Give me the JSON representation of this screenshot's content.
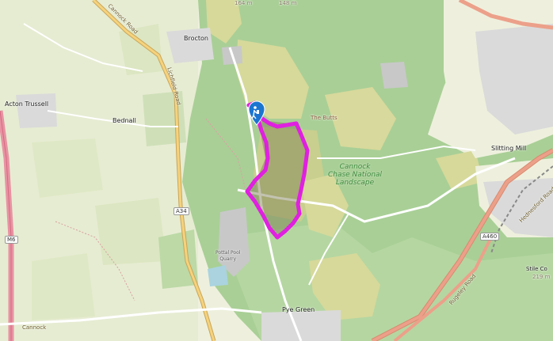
{
  "map": {
    "labels": {
      "acton_trussell": "Acton Trussell",
      "bednall": "Bednall",
      "brocton": "Brocton",
      "slitting_mill": "Slitting Mill",
      "cannock_chase_line1": "Cannock",
      "cannock_chase_line2": "Chase National",
      "cannock_chase_line3": "Landscape",
      "the_butts": "The Butts",
      "pottal_pool_line1": "Pottal Pool",
      "pottal_pool_line2": "Quarry",
      "pye_green": "Pye Green",
      "a34": "A34",
      "a460": "A460",
      "m6": "M6",
      "cannock_road": "Cannock Road",
      "lichfield_road": "Lichfield Road",
      "hednesford_road": "Hednesford Road",
      "rugeley_road": "Rugeley Road",
      "cannock_road_bottom": "Cannock",
      "stile_cop": "Stile Co",
      "stile_cop_height": "219 m",
      "contour_top1": "164 m",
      "contour_top2": "148 m"
    },
    "route": {
      "color": "#e020e0",
      "start_icon": "hiking-person-icon"
    },
    "colors": {
      "woodland": "#a9cf96",
      "heath": "#d6d99a",
      "farmland": "#eef0dd",
      "urban": "#dadada",
      "major_road": "#e8927c",
      "road": "#f7fabf",
      "water": "#aad3df"
    }
  }
}
